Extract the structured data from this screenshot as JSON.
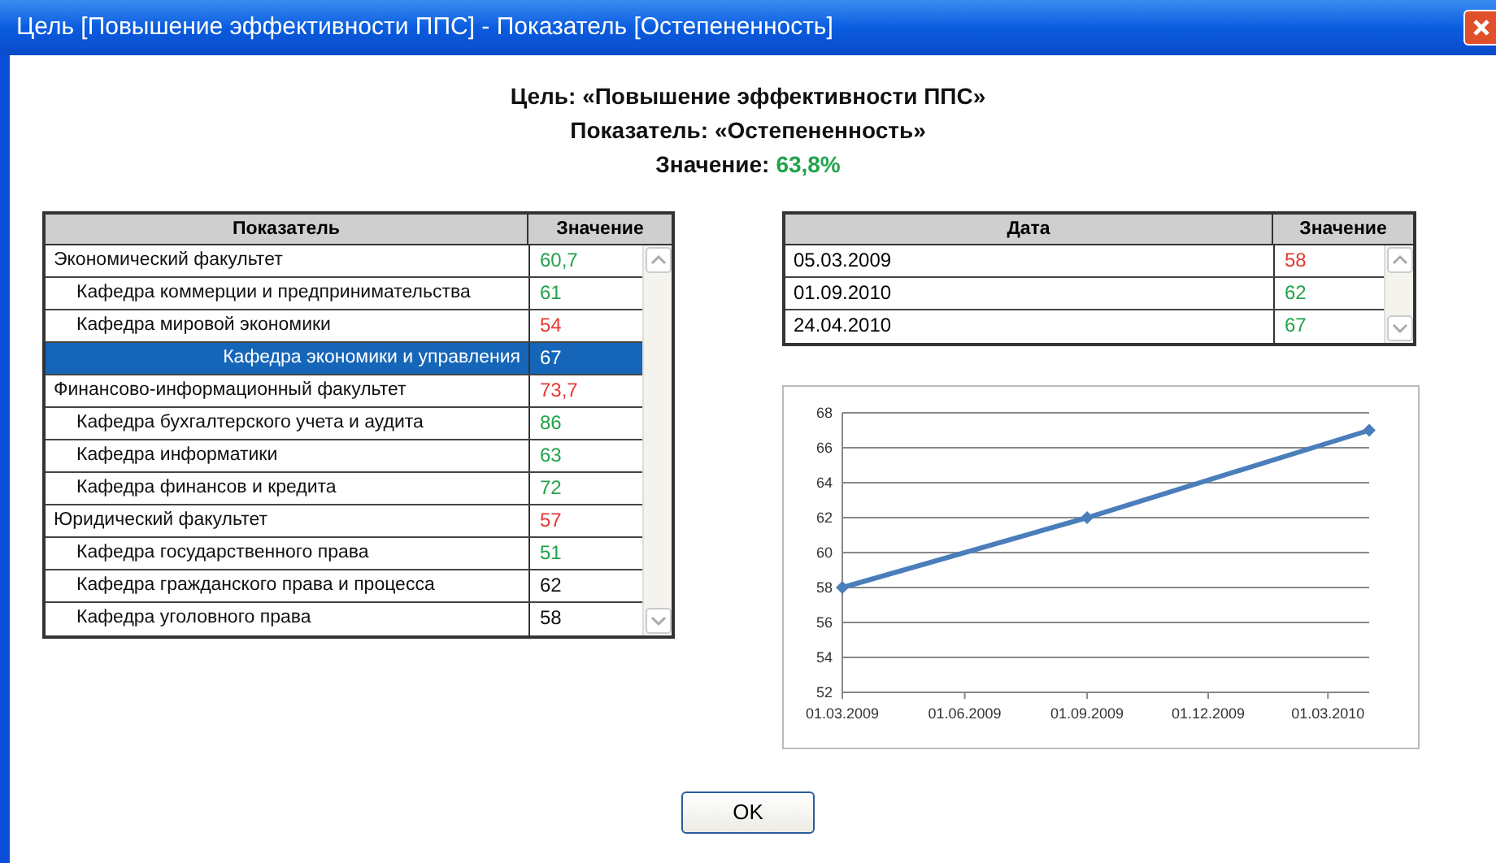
{
  "window": {
    "title": "Цель [Повышение эффективности ППС] - Показатель [Остепененность]"
  },
  "header": {
    "goal": "Цель: «Повышение эффективности ППС»",
    "indicator": "Показатель: «Остепененность»",
    "value_label": "Значение:",
    "value": "63,8%"
  },
  "indicator_table": {
    "columns": [
      "Показатель",
      "Значение"
    ],
    "rows": [
      {
        "name": "Экономический факультет",
        "value": "60,7",
        "color": "#22a34a",
        "selected": false,
        "children": [
          {
            "name": "Кафедра коммерции и предпринимательства",
            "value": "61",
            "color": "#22a34a",
            "selected": false
          },
          {
            "name": "Кафедра мировой экономики",
            "value": "54",
            "color": "#e53935",
            "selected": false
          },
          {
            "name": "Кафедра экономики и управления",
            "value": "67",
            "selected": true
          }
        ]
      },
      {
        "name": "Финансово-информационный факультет",
        "value": "73,7",
        "color": "#e53935",
        "selected": false,
        "children": [
          {
            "name": "Кафедра бухгалтерского учета и аудита",
            "value": "86",
            "color": "#22a34a",
            "selected": false
          },
          {
            "name": "Кафедра информатики",
            "value": "63",
            "color": "#22a34a",
            "selected": false
          },
          {
            "name": "Кафедра финансов и кредита",
            "value": "72",
            "color": "#22a34a",
            "selected": false
          }
        ]
      },
      {
        "name": "Юридический факультет",
        "value": "57",
        "color": "#e53935",
        "selected": false,
        "children": [
          {
            "name": "Кафедра государственного права",
            "value": "51",
            "color": "#22a34a",
            "selected": false
          },
          {
            "name": "Кафедра гражданского права и процесса",
            "value": "62",
            "color": "#111111",
            "selected": false
          },
          {
            "name": "Кафедра уголовного права",
            "value": "58",
            "color": "#111111",
            "selected": false
          }
        ]
      }
    ]
  },
  "history_table": {
    "columns": [
      "Дата",
      "Значение"
    ],
    "rows": [
      {
        "date": "05.03.2009",
        "value": "58",
        "color": "#e53935"
      },
      {
        "date": "01.09.2010",
        "value": "62",
        "color": "#22a34a"
      },
      {
        "date": "24.04.2010",
        "value": "67",
        "color": "#22a34a"
      }
    ]
  },
  "chart": {
    "chart_data": {
      "type": "line",
      "x": [
        "2009-03-01",
        "2009-09-01",
        "2010-04-01"
      ],
      "grid": "y",
      "series": [
        {
          "color": "#4a7ebb",
          "marker": "diamond",
          "values": [
            58,
            62,
            67
          ]
        }
      ],
      "xlim": [
        "2009-03-01",
        "2010-04-01"
      ],
      "ylim": [
        52,
        68
      ],
      "xticks": [
        {
          "value": "2009-03-01",
          "label": "01.03.2009"
        },
        {
          "value": "2009-06-01",
          "label": "01.06.2009"
        },
        {
          "value": "2009-09-01",
          "label": "01.09.2009"
        },
        {
          "value": "2009-12-01",
          "label": "01.12.2009"
        },
        {
          "value": "2010-03-01",
          "label": "01.03.2010"
        }
      ],
      "yticks": [
        52,
        54,
        56,
        58,
        60,
        62,
        64,
        66,
        68
      ]
    }
  },
  "buttons": [
    "OK"
  ]
}
